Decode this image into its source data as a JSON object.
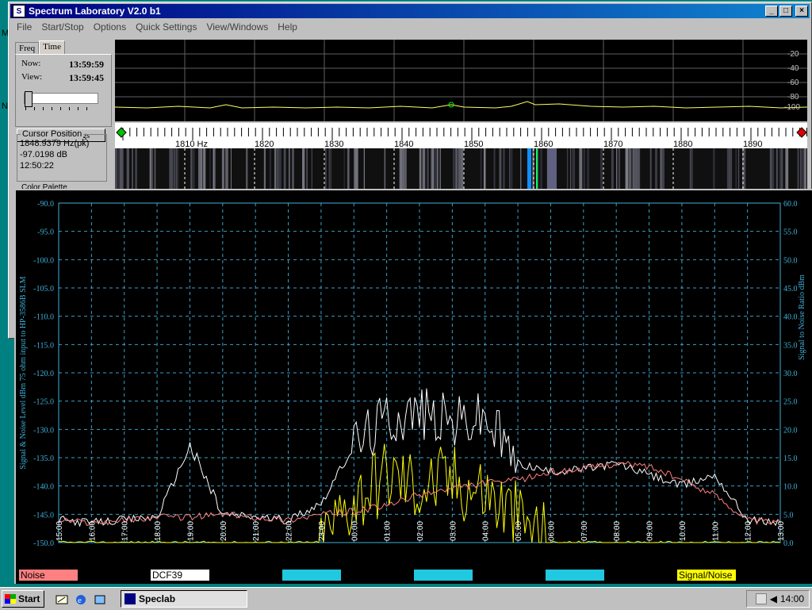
{
  "window": {
    "title": "Spectrum Laboratory V2.0 b1",
    "buttons": {
      "minimize": "_",
      "maximize": "□",
      "close": "×"
    }
  },
  "menu": [
    "File",
    "Start/Stop",
    "Options",
    "Quick Settings",
    "View/Windows",
    "Help"
  ],
  "left_panel": {
    "tabs": [
      "Freq",
      "Time"
    ],
    "active_tab": "Time",
    "now_label": "Now:",
    "now_value": "13:59:59",
    "view_label": "View:",
    "view_value": "13:59:45",
    "display_settings": "Display Settings",
    "cursor_title": "Cursor Position",
    "cursor_freq": "1848.9379 Hz(pk)",
    "cursor_level": "-97.0198 dB",
    "cursor_time": "12:50:22",
    "color_palette": "Color Palette"
  },
  "spectrum": {
    "db_labels": [
      "-20",
      "-40",
      "-60",
      "-80",
      "-100"
    ],
    "freq_labels": [
      "1810 Hz",
      "1820",
      "1830",
      "1840",
      "1850",
      "1860",
      "1870",
      "1880",
      "1890"
    ]
  },
  "chart_data": {
    "type": "line",
    "ylabel_left": "Signal & Noise Level  dBm 75 ohm input to HP-3586B SLM",
    "ylabel_right": "Signal to Noise Ratio  dBm",
    "y_left_ticks": [
      "-90.0",
      "-95.0",
      "-100.0",
      "-105.0",
      "-110.0",
      "-115.0",
      "-120.0",
      "-125.0",
      "-130.0",
      "-135.0",
      "-140.0",
      "-145.0",
      "-150.0"
    ],
    "y_right_ticks": [
      "60.0",
      "55.0",
      "50.0",
      "45.0",
      "40.0",
      "35.0",
      "30.0",
      "25.0",
      "20.0",
      "15.0",
      "10.0",
      "5.0",
      "0.0"
    ],
    "ylim_left": [
      -150,
      -90
    ],
    "ylim_right": [
      0,
      60
    ],
    "x_ticks": [
      "15:00",
      "16:00",
      "17:00",
      "18:00",
      "19:00",
      "20:00",
      "21:00",
      "22:00",
      "23:00",
      "00:00",
      "01:00",
      "02:00",
      "03:00",
      "04:00",
      "05:00",
      "06:00",
      "07:00",
      "08:00",
      "09:00",
      "10:00",
      "11:00",
      "12:00",
      "13:00"
    ],
    "series": [
      {
        "name": "Noise",
        "color": "#ff8080",
        "values": [
          -146,
          -146.5,
          -146,
          -145.5,
          -145.5,
          -145,
          -145.5,
          -146,
          -145,
          -144.5,
          -143.5,
          -141.5,
          -140.5,
          -139.5,
          -139,
          -137.5,
          -137,
          -136,
          -136.5,
          -139,
          -141.5,
          -146,
          -146.5
        ]
      },
      {
        "name": "DCF39",
        "color": "#ffffff",
        "values": [
          -146,
          -146.5,
          -146,
          -145.5,
          -133,
          -145,
          -145.5,
          -146,
          -143,
          -133,
          -128,
          -127,
          -129,
          -128,
          -136,
          -137.5,
          -137,
          -136,
          -138,
          -140,
          -138,
          -146,
          -146.5
        ]
      },
      {
        "name": "Signal/Noise",
        "color": "#ffff00",
        "values_right_axis": [
          0,
          0,
          0,
          0,
          0,
          0,
          0,
          0,
          0,
          8,
          12,
          10,
          11,
          9,
          4,
          0,
          0,
          0,
          0,
          0,
          0,
          0,
          0
        ]
      }
    ],
    "legend": [
      "Noise",
      "DCF39",
      "",
      "",
      "",
      "Signal/Noise"
    ]
  },
  "taskbar": {
    "start": "Start",
    "task": "Speclab",
    "clock": "14:00"
  }
}
